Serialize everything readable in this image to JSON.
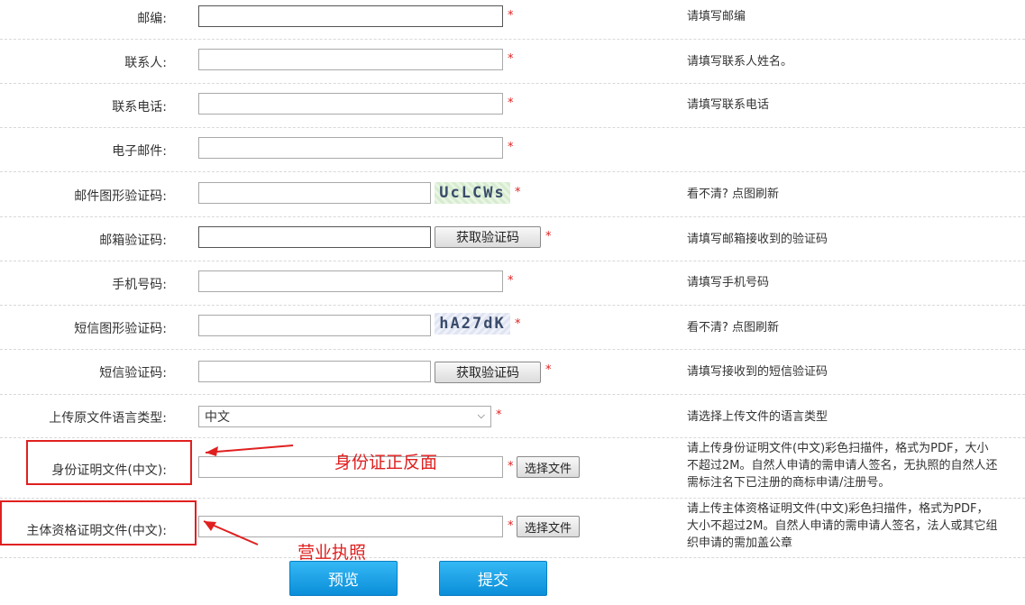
{
  "rows": [
    {
      "label": "邮编:",
      "hint": "请填写邮编"
    },
    {
      "label": "联系人:",
      "hint": "请填写联系人姓名。"
    },
    {
      "label": "联系电话:",
      "hint": "请填写联系电话"
    },
    {
      "label": "电子邮件:",
      "hint": ""
    },
    {
      "label": "邮件图形验证码:",
      "hint": "看不清? 点图刷新",
      "captcha": "UcLCWs"
    },
    {
      "label": "邮箱验证码:",
      "hint": "请填写邮箱接收到的验证码",
      "button": "获取验证码"
    },
    {
      "label": "手机号码:",
      "hint": "请填写手机号码"
    },
    {
      "label": "短信图形验证码:",
      "hint": "看不清? 点图刷新",
      "captcha": "hA27dK"
    },
    {
      "label": "短信验证码:",
      "hint": "请填写接收到的短信验证码",
      "button": "获取验证码"
    },
    {
      "label": "上传原文件语言类型:",
      "hint": "请选择上传文件的语言类型",
      "selected": "中文"
    },
    {
      "label": "身份证明文件(中文):",
      "hint": "请上传身份证明文件(中文)彩色扫描件，格式为PDF，大小不超过2M。自然人申请的需申请人签名，无执照的自然人还需标注名下已注册的商标申请/注册号。",
      "button": "选择文件"
    },
    {
      "label": "主体资格证明文件(中文):",
      "hint": "请上传主体资格证明文件(中文)彩色扫描件，格式为PDF，大小不超过2M。自然人申请的需申请人签名，法人或其它组织申请的需加盖公章",
      "button": "选择文件"
    }
  ],
  "required_mark": "*",
  "actions": {
    "preview": "预览",
    "submit": "提交"
  },
  "annotations": {
    "id_card": "身份证正反面",
    "license": "营业执照"
  },
  "colors": {
    "required": "#e02020",
    "annotation": "#e02020",
    "button_blue": "#0a8ed8"
  }
}
